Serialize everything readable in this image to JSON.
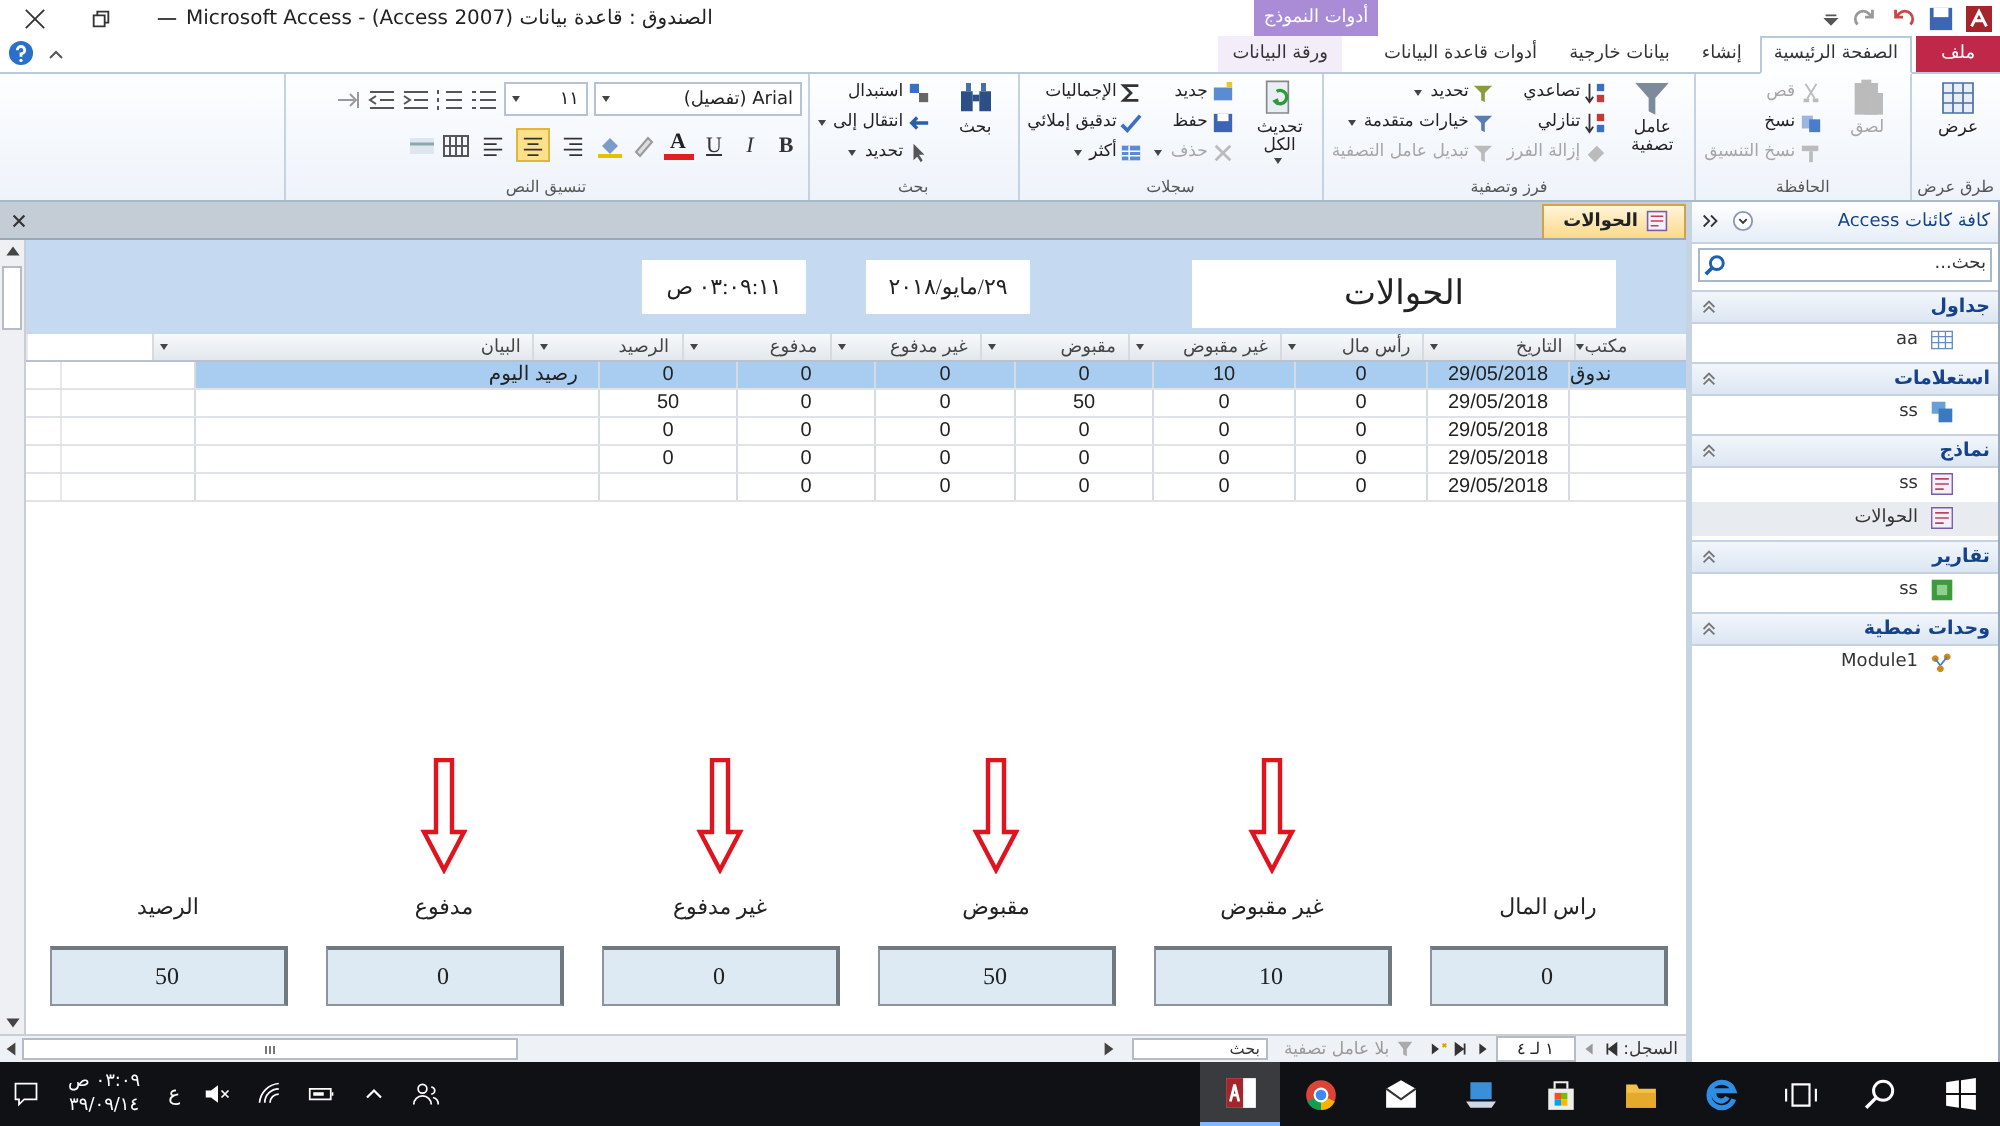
{
  "window": {
    "title": "Microsoft Access - (Access 2007) الصندوق : قاعدة بيانات",
    "contextual_tab": "أدوات النموذج"
  },
  "ribbon_tabs": [
    {
      "label": "ملف",
      "kind": "file",
      "selected": false
    },
    {
      "label": "الصفحة الرئيسية",
      "kind": "tab",
      "selected": true
    },
    {
      "label": "إنشاء",
      "kind": "tab",
      "selected": false
    },
    {
      "label": "بيانات خارجية",
      "kind": "tab",
      "selected": false
    },
    {
      "label": "أدوات قاعدة البيانات",
      "kind": "tab",
      "selected": false
    },
    {
      "label": "ورقة البيانات",
      "kind": "contextual",
      "selected": false
    }
  ],
  "ribbon": {
    "groups": [
      {
        "label": "طرق عرض",
        "commands": [
          {
            "label": "عرض",
            "kind": "view",
            "disabled": false
          }
        ]
      },
      {
        "label": "الحافظة",
        "commands": [
          {
            "label": "لصق",
            "kind": "paste",
            "disabled": true
          },
          {
            "label": "قص",
            "kind": "cut",
            "disabled": true
          },
          {
            "label": "نسخ",
            "kind": "copy",
            "disabled": false
          },
          {
            "label": "نسخ التنسيق",
            "kind": "painter",
            "disabled": true
          }
        ]
      },
      {
        "label": "فرز وتصفية",
        "commands": [
          {
            "label": "عامل تصفية",
            "kind": "filter",
            "disabled": false
          },
          {
            "label": "تصاعدي",
            "kind": "asc",
            "disabled": false
          },
          {
            "label": "تنازلي",
            "kind": "desc",
            "disabled": false
          },
          {
            "label": "إزالة الفرز",
            "kind": "remove_sort",
            "disabled": true
          },
          {
            "label": "تحديد",
            "kind": "selection",
            "disabled": false
          },
          {
            "label": "خيارات متقدمة",
            "kind": "advanced",
            "disabled": false
          },
          {
            "label": "تبديل عامل التصفية",
            "kind": "toggle",
            "disabled": true
          }
        ]
      },
      {
        "label": "سجلات",
        "commands": [
          {
            "label": "تحديث الكل",
            "kind": "refresh",
            "disabled": false
          },
          {
            "label": "جديد",
            "kind": "new",
            "disabled": false
          },
          {
            "label": "حفظ",
            "kind": "save",
            "disabled": false
          },
          {
            "label": "حذف",
            "kind": "delete",
            "disabled": true
          },
          {
            "label": "الإجماليات",
            "kind": "totals",
            "disabled": false
          },
          {
            "label": "تدقيق إملائي",
            "kind": "spelling",
            "disabled": false
          },
          {
            "label": "أكثر",
            "kind": "more",
            "disabled": false
          }
        ]
      },
      {
        "label": "بحث",
        "commands": [
          {
            "label": "بحث",
            "kind": "find",
            "disabled": false
          },
          {
            "label": "استبدال",
            "kind": "replace",
            "disabled": false
          },
          {
            "label": "انتقال إلى",
            "kind": "goto",
            "disabled": false
          },
          {
            "label": "تحديد",
            "kind": "select",
            "disabled": false
          }
        ]
      }
    ],
    "text_formatting": {
      "label": "تنسيق النص",
      "font": "Arial (تفصيل)",
      "size": "١١",
      "bold": "B",
      "italic": "I",
      "underline": "U",
      "font_color": "A",
      "alignment": [
        {
          "selected": false
        },
        {
          "selected": true
        },
        {
          "selected": false
        }
      ]
    }
  },
  "document_tab": {
    "label": "الحوالات"
  },
  "form": {
    "title": "الحوالات",
    "date": "٢٩/مايو/٢٠١٨",
    "time": "٠٣:٠٩:١١ ص"
  },
  "datasheet": {
    "columns": [
      "مكتب",
      "التاريخ",
      "رأس مال",
      "غير مقبوض",
      "مقبوض",
      "غير مدفوع",
      "مدفوع",
      "الرصيد",
      "البيان"
    ],
    "rows": [
      {
        "selected": true,
        "cells": [
          "ندوق",
          "29/05/2018",
          "0",
          "10",
          "0",
          "0",
          "0",
          "0",
          "رصيد اليوم"
        ]
      },
      {
        "selected": false,
        "cells": [
          null,
          "29/05/2018",
          "0",
          "0",
          "50",
          "0",
          "0",
          "50",
          null
        ]
      },
      {
        "selected": false,
        "cells": [
          null,
          "29/05/2018",
          "0",
          "0",
          "0",
          "0",
          "0",
          "0",
          null
        ]
      },
      {
        "selected": false,
        "cells": [
          null,
          "29/05/2018",
          "0",
          "0",
          "0",
          "0",
          "0",
          "0",
          null
        ]
      },
      {
        "selected": false,
        "cells": [
          null,
          "29/05/2018",
          "0",
          "0",
          "0",
          "0",
          "0",
          null,
          null
        ]
      }
    ]
  },
  "totals": [
    {
      "label": "راس المال",
      "value": "0",
      "marked": false
    },
    {
      "label": "غير مقبوض",
      "value": "10",
      "marked": true
    },
    {
      "label": "مقبوض",
      "value": "50",
      "marked": true
    },
    {
      "label": "غير مدفوع",
      "value": "0",
      "marked": true
    },
    {
      "label": "مدفوع",
      "value": "0",
      "marked": true
    },
    {
      "label": "الرصيد",
      "value": "50",
      "marked": false
    }
  ],
  "record_nav": {
    "label": "السجل:",
    "position": "١ لـ ٤",
    "filter": "بلا عامل تصفية",
    "search_placeholder": "بحث"
  },
  "nav_pane": {
    "title": "كافة كائنات Access",
    "search_placeholder": "بحث...",
    "groups": [
      {
        "label": "جداول",
        "items": [
          {
            "label": "aa",
            "kind": "table",
            "selected": false
          }
        ]
      },
      {
        "label": "استعلامات",
        "items": [
          {
            "label": "ss",
            "kind": "query",
            "selected": false
          }
        ]
      },
      {
        "label": "نماذج",
        "items": [
          {
            "label": "ss",
            "kind": "form",
            "selected": false
          },
          {
            "label": "الحوالات",
            "kind": "form",
            "selected": true
          }
        ]
      },
      {
        "label": "تقارير",
        "items": [
          {
            "label": "ss",
            "kind": "report",
            "selected": false
          }
        ]
      },
      {
        "label": "وحدات نمطية",
        "items": [
          {
            "label": "Module1",
            "kind": "module",
            "selected": false
          }
        ]
      }
    ]
  },
  "taskbar": {
    "time": "٠٣:٠٩ ص",
    "date": "٣٩/٠٩/١٤",
    "language": "ع",
    "apps": [
      {
        "kind": "start",
        "selected": false
      },
      {
        "kind": "search",
        "selected": false
      },
      {
        "kind": "taskview",
        "selected": false
      },
      {
        "kind": "edge",
        "selected": false
      },
      {
        "kind": "folder",
        "selected": false
      },
      {
        "kind": "store",
        "selected": false
      },
      {
        "kind": "laptop",
        "selected": false
      },
      {
        "kind": "mail",
        "selected": false
      },
      {
        "kind": "chrome",
        "selected": false
      },
      {
        "kind": "access",
        "selected": true
      }
    ]
  }
}
